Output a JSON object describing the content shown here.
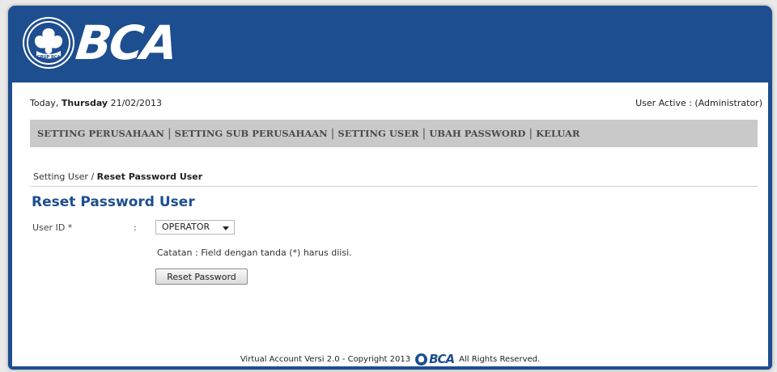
{
  "brand": {
    "name": "BCA",
    "badge_text": "GRUP BCA",
    "primary_color": "#1d4e8f"
  },
  "topline": {
    "today_prefix": "Today, ",
    "today_day": "Thursday",
    "today_date": " 21/02/2013",
    "user_active": "User Active : (Administrator)"
  },
  "nav": {
    "items": [
      {
        "label": "SETTING PERUSAHAAN"
      },
      {
        "label": "SETTING SUB PERUSAHAAN"
      },
      {
        "label": "SETTING USER"
      },
      {
        "label": "UBAH PASSWORD"
      },
      {
        "label": "KELUAR"
      }
    ],
    "separator": "|"
  },
  "breadcrumb": {
    "parent": "Setting User",
    "sep": " / ",
    "current": "Reset Password User"
  },
  "page": {
    "title": "Reset Password User"
  },
  "form": {
    "user_id_label": "User ID *",
    "colon": ":",
    "user_id_value": "OPERATOR",
    "note": "Catatan : Field dengan tanda (*) harus diisi.",
    "reset_button": "Reset Password"
  },
  "footer": {
    "left": "Virtual Account Versi 2.0 - Copyright 2013",
    "logo_text": "BCA",
    "right": "All Rights Reserved."
  }
}
